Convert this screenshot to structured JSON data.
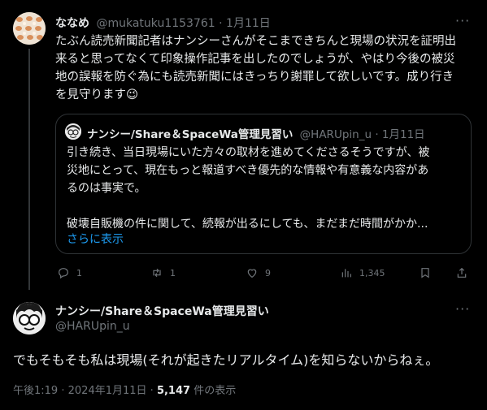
{
  "tweet1": {
    "display_name": "ななめ",
    "handle": "@mukatuku1153761",
    "sep": "·",
    "date": "1月11日",
    "text_lines": [
      "たぶん読売新聞記者はナンシーさんがそこまできちんと現場の状況を証明出",
      "来ると思ってなくて印象操作記事を出したのでしょうが、やはり今後の被災",
      "地の誤報を防ぐ為にも読売新聞にはきっちり謝罪して欲しいです。成り行き",
      "を見守ります"
    ],
    "emoji": "😉",
    "quoted": {
      "display_name": "ナンシー/Share＆SpaceWa管理見習い",
      "handle": "@HARUpin_u",
      "sep": "·",
      "date": "1月11日",
      "text_lines": [
        "引き続き、当日現場にいた方々の取材を進めてくださるそうですが、被",
        "災地にとって、現在もっと報道すべき優先的な情報や有意義な内容があ",
        "るのは事実で。",
        "",
        "破壊自販機の件に関して、続報が出るにしても、まだまだ時間がかか..."
      ],
      "show_more": "さらに表示"
    },
    "actions": {
      "replies": "1",
      "retweets": "1",
      "likes": "9",
      "views": "1,345"
    }
  },
  "tweet2": {
    "display_name": "ナンシー/Share＆SpaceWa管理見習い",
    "handle": "@HARUpin_u",
    "text": "でもそもそも私は現場(それが起きたリアルタイム)を知らないからねぇ。",
    "meta": {
      "time": "午後1:19",
      "sep1": "·",
      "date": "2024年1月11日",
      "sep2": "·",
      "views_count": "5,147",
      "views_label": "件の表示"
    }
  },
  "colors": {
    "background": "#000000",
    "text": "#e7e9ea",
    "muted": "#71767b",
    "link": "#1d9bf0",
    "border": "#2f3336"
  }
}
